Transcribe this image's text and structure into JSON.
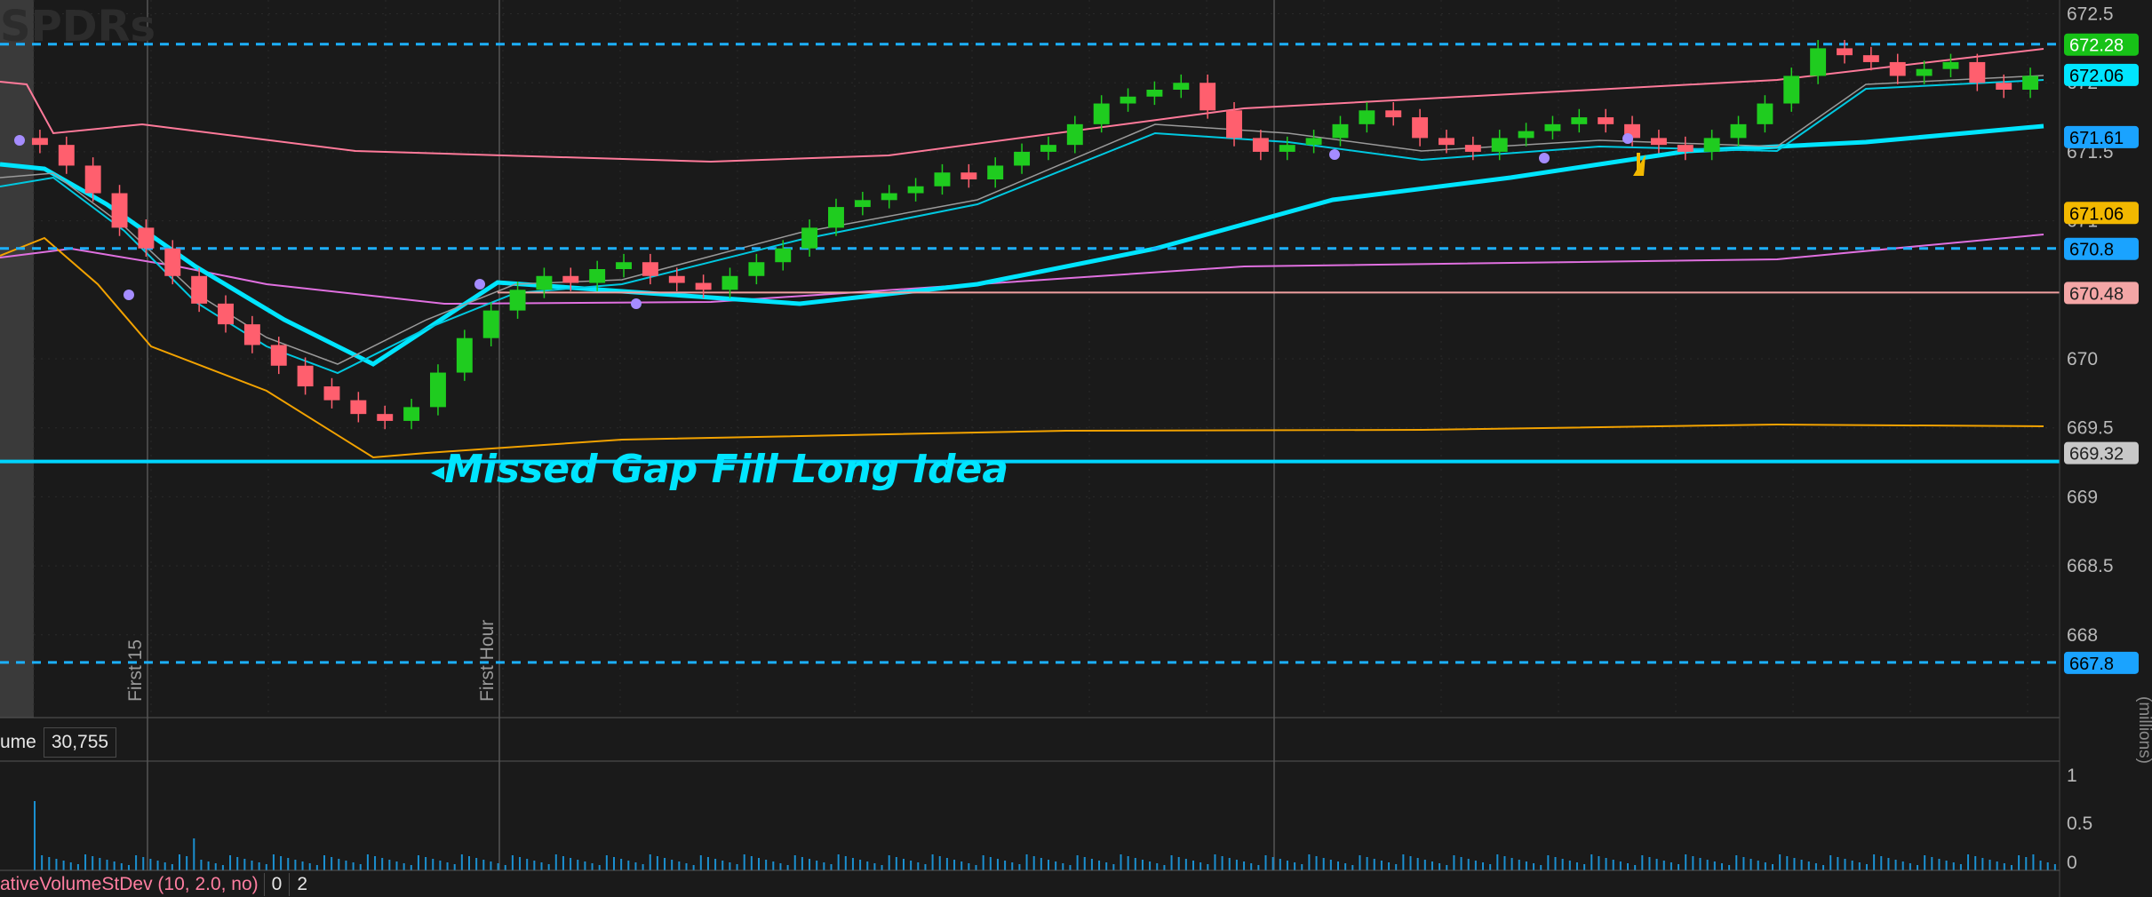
{
  "watermark": "SPDRs",
  "annotation": {
    "text": "Missed Gap Fill Long Idea"
  },
  "markers": {
    "first15": "First 15",
    "first_hour": "First Hour"
  },
  "price_axis": {
    "ticks": [
      "672.5",
      "672",
      "671.5",
      "671",
      "670",
      "669.5",
      "669",
      "668.5",
      "668"
    ],
    "min": 667.4,
    "max": 672.6
  },
  "price_tags": [
    {
      "value": "672.28",
      "price": 672.28,
      "bg": "#17c217",
      "fg": "#ffffff",
      "style": "dashed",
      "line": "#1cb0ff"
    },
    {
      "value": "672.06",
      "price": 672.06,
      "bg": "#00e5ff",
      "fg": "#000000",
      "style": "none",
      "line": ""
    },
    {
      "value": "671.61",
      "price": 671.61,
      "bg": "#1aa3ff",
      "fg": "#000000",
      "style": "none",
      "line": ""
    },
    {
      "value": "671.06",
      "price": 671.06,
      "bg": "#f2b800",
      "fg": "#000000",
      "style": "none",
      "line": ""
    },
    {
      "value": "670.8",
      "price": 670.8,
      "bg": "#1aa3ff",
      "fg": "#000000",
      "style": "dashed",
      "line": "#1cb0ff"
    },
    {
      "value": "670.48",
      "price": 670.48,
      "bg": "#f4a6a6",
      "fg": "#222222",
      "style": "solid",
      "line": "#f0a0a0"
    },
    {
      "value": "669.32",
      "price": 669.32,
      "bg": "#c8c8c8",
      "fg": "#222222",
      "style": "thick",
      "line": "#00d5ff"
    },
    {
      "value": "667.8",
      "price": 667.8,
      "bg": "#1aa3ff",
      "fg": "#000000",
      "style": "dashed",
      "line": "#1cb0ff"
    }
  ],
  "volume_panel": {
    "label": "ume",
    "value": "30,755",
    "ticks": [
      "1",
      "0.5",
      "0"
    ],
    "unit": "(millions)"
  },
  "study_panel": {
    "label": "ativeVolumeStDev (10, 2.0, no)",
    "values": [
      "0",
      "2"
    ]
  },
  "colors": {
    "background": "#1a1a1a",
    "up_candle": "#1fcc1f",
    "down_candle": "#ff5f6e",
    "vwap": "#00e5ff",
    "upper_band": "#ff7a9a",
    "mid_band": "#e070e0",
    "lower_band": "#f2a200"
  },
  "chart_data": {
    "type": "candlestick",
    "ylim": [
      667.4,
      672.6
    ],
    "closes": [
      671.55,
      671.4,
      671.2,
      670.95,
      670.8,
      670.6,
      670.4,
      670.25,
      670.1,
      669.95,
      669.8,
      669.7,
      669.6,
      669.55,
      669.65,
      669.9,
      670.15,
      670.35,
      670.5,
      670.6,
      670.55,
      670.65,
      670.7,
      670.6,
      670.55,
      670.5,
      670.6,
      670.7,
      670.8,
      670.95,
      671.1,
      671.15,
      671.2,
      671.25,
      671.35,
      671.3,
      671.4,
      671.5,
      671.55,
      671.7,
      671.85,
      671.9,
      671.95,
      672.0,
      671.8,
      671.6,
      671.5,
      671.55,
      671.6,
      671.7,
      671.8,
      671.75,
      671.6,
      671.55,
      671.5,
      671.6,
      671.65,
      671.7,
      671.75,
      671.7,
      671.6,
      671.55,
      671.5,
      671.6,
      671.7,
      671.85,
      672.05,
      672.25,
      672.2,
      672.15,
      672.05,
      672.1,
      672.15,
      672.0,
      671.95,
      672.05
    ]
  }
}
